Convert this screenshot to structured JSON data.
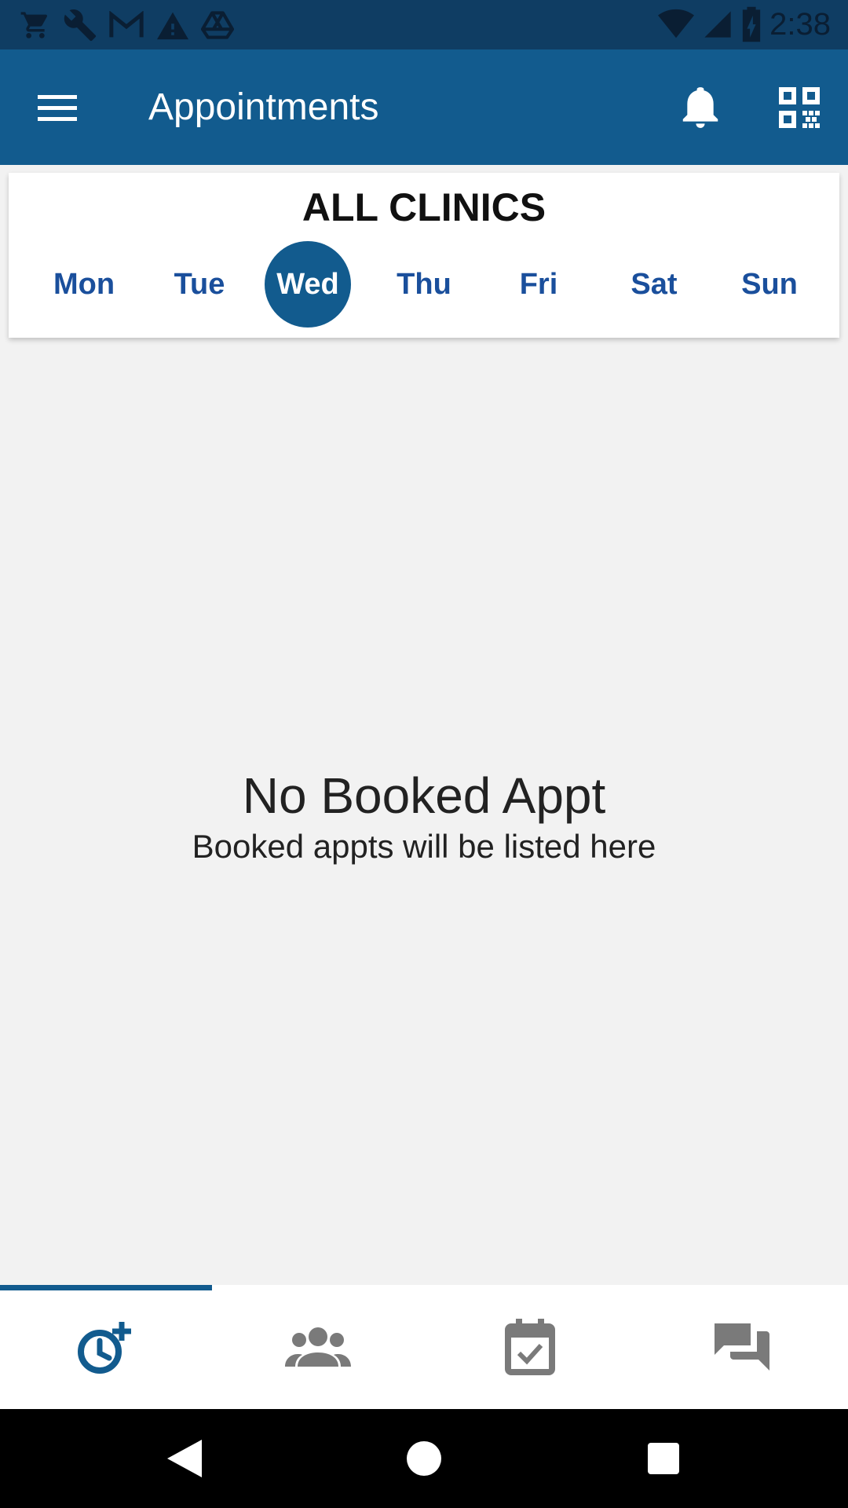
{
  "status_bar": {
    "time": "2:38",
    "left_icons": [
      "cart-icon",
      "wrench-icon",
      "gmail-icon",
      "warning-icon",
      "drive-icon"
    ],
    "right_icons": [
      "wifi-icon",
      "signal-icon",
      "battery-charging-icon"
    ]
  },
  "app_bar": {
    "title": "Appointments",
    "color": "#125b8e"
  },
  "clinic_selector": {
    "title": "ALL CLINICS",
    "days": [
      "Mon",
      "Tue",
      "Wed",
      "Thu",
      "Fri",
      "Sat",
      "Sun"
    ],
    "selected_day": "Wed"
  },
  "empty_state": {
    "title": "No Booked Appt",
    "subtitle": "Booked appts will be listed here"
  },
  "bottom_nav": {
    "tabs": [
      "clock-plus-icon",
      "people-icon",
      "calendar-check-icon",
      "chat-icon"
    ],
    "active_tab": 0,
    "active_color": "#125b8e",
    "inactive_color": "#7a7a7a"
  }
}
